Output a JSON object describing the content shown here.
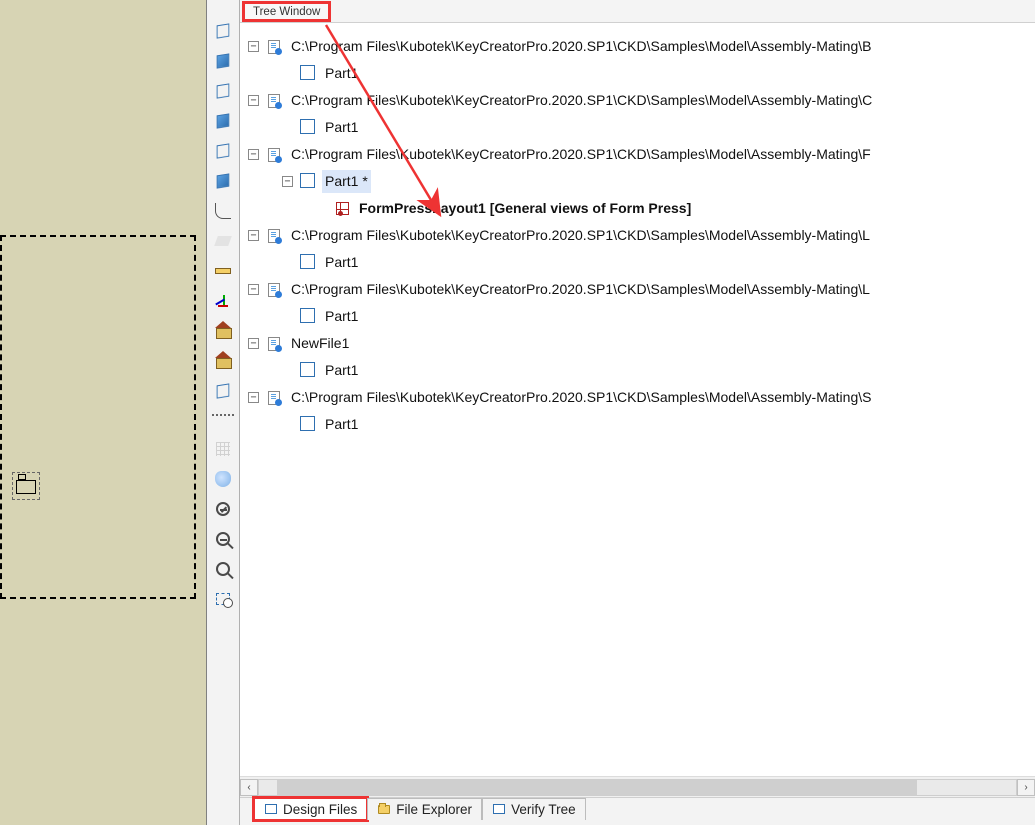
{
  "panel": {
    "title": "Tree Window"
  },
  "paths": {
    "p1": "C:\\Program Files\\Kubotek\\KeyCreatorPro.2020.SP1\\CKD\\Samples\\Model\\Assembly-Mating\\B",
    "p2": "C:\\Program Files\\Kubotek\\KeyCreatorPro.2020.SP1\\CKD\\Samples\\Model\\Assembly-Mating\\C",
    "p3": "C:\\Program Files\\Kubotek\\KeyCreatorPro.2020.SP1\\CKD\\Samples\\Model\\Assembly-Mating\\F",
    "p4": "C:\\Program Files\\Kubotek\\KeyCreatorPro.2020.SP1\\CKD\\Samples\\Model\\Assembly-Mating\\L",
    "p5": "C:\\Program Files\\Kubotek\\KeyCreatorPro.2020.SP1\\CKD\\Samples\\Model\\Assembly-Mating\\L",
    "p6": "NewFile1",
    "p7": "C:\\Program Files\\Kubotek\\KeyCreatorPro.2020.SP1\\CKD\\Samples\\Model\\Assembly-Mating\\S"
  },
  "parts": {
    "part": "Part1",
    "part_modified": "Part1 *"
  },
  "layout": {
    "name": "FormPressLayout1 [General views of Form Press]"
  },
  "tabs": {
    "design": "Design Files",
    "explorer": "File Explorer",
    "verify": "Verify Tree"
  },
  "exp": {
    "minus": "−",
    "plus": "+"
  },
  "scroll": {
    "left": "‹",
    "right": "›"
  }
}
